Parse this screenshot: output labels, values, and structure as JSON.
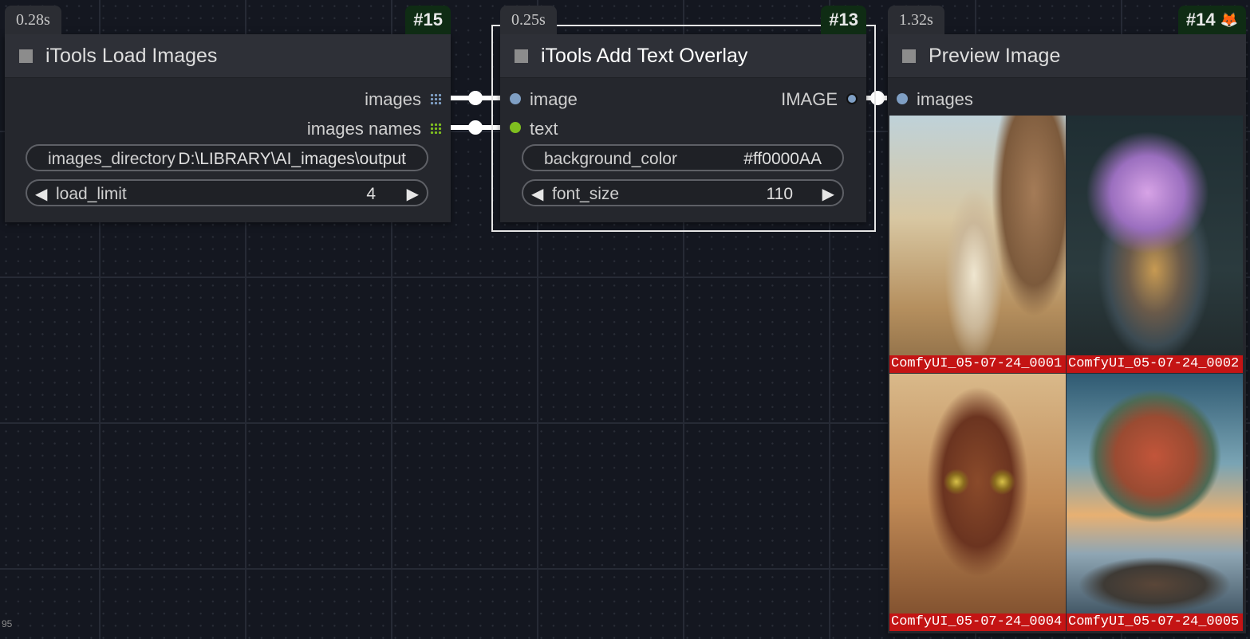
{
  "zoom_hint": "95",
  "nodes": {
    "load_images": {
      "time": "0.28s",
      "id": "#15",
      "title": "iTools Load Images",
      "outputs": [
        "images",
        "images names"
      ],
      "widgets": {
        "images_directory": {
          "label": "images_directory",
          "value": "D:\\LIBRARY\\AI_images\\output"
        },
        "load_limit": {
          "label": "load_limit",
          "value": "4"
        }
      }
    },
    "text_overlay": {
      "time": "0.25s",
      "id": "#13",
      "title": "iTools Add Text Overlay",
      "inputs": [
        "image",
        "text"
      ],
      "output": "IMAGE",
      "widgets": {
        "background_color": {
          "label": "background_color",
          "value": "#ff0000AA"
        },
        "font_size": {
          "label": "font_size",
          "value": "110"
        }
      }
    },
    "preview": {
      "time": "1.32s",
      "id": "#14",
      "title": "Preview Image",
      "input": "images",
      "images": [
        {
          "caption": "ComfyUI_05-07-24_0001"
        },
        {
          "caption": "ComfyUI_05-07-24_0002"
        },
        {
          "caption": "ComfyUI_05-07-24_0004"
        },
        {
          "caption": "ComfyUI_05-07-24_0005"
        }
      ]
    }
  },
  "colors": {
    "image_socket": "#7f9fc4",
    "text_socket": "#7fbf1f",
    "link": "#ffffff",
    "id_badge": "#0f2c14",
    "caption_bg": "#c41414"
  },
  "icons": {
    "arrow_left": "◀",
    "arrow_right": "▶",
    "fox": "🦊"
  }
}
